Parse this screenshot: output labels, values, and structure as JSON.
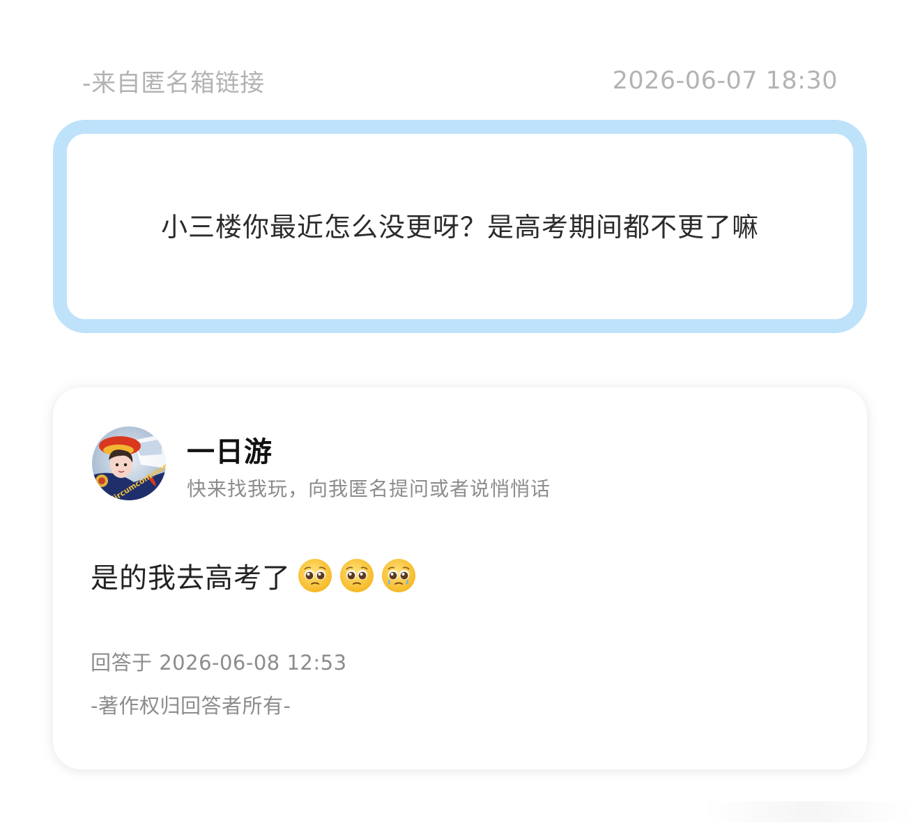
{
  "meta": {
    "source": "-来自匿名箱链接",
    "asked_at": "2026-06-07 18:30"
  },
  "question": {
    "text": "小三楼你最近怎么没更呀？是高考期间都不更了嘛",
    "border_color": "#bfe2fb"
  },
  "answer": {
    "user_name": "一日游",
    "user_bio": "快来找我玩，向我匿名提问或者说悄悄话",
    "avatar_text": "Circumcontinental",
    "text": "是的我去高考了",
    "emojis": [
      "pleading-face-emoji",
      "pleading-face-emoji",
      "pleading-face-emoji"
    ],
    "answered_at": "回答于 2026-06-08 12:53",
    "copyright": "-著作权归回答者所有-"
  },
  "colors": {
    "muted_text": "#b3b3b3",
    "secondary_text": "#8c8c8c",
    "primary_text": "#222222"
  }
}
